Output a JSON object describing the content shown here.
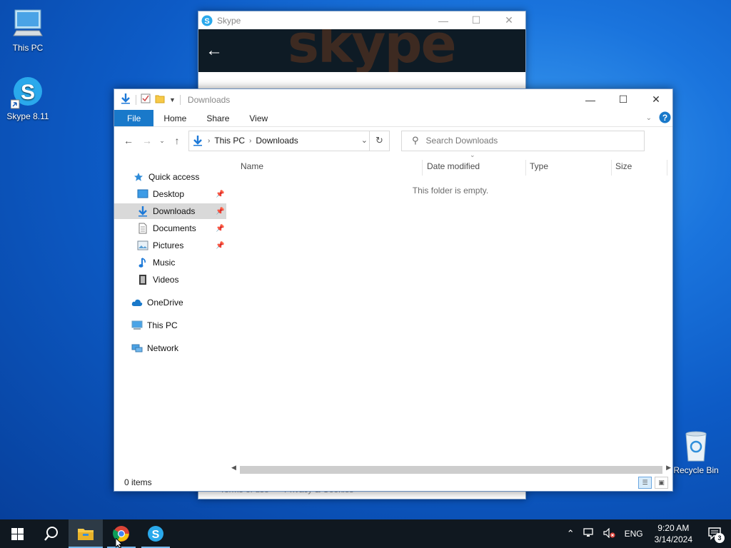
{
  "desktop": {
    "icons": [
      {
        "label": "This PC",
        "icon": "computer-icon"
      },
      {
        "label": "Skype 8.11",
        "icon": "skype-icon"
      },
      {
        "label": "Recycle Bin",
        "icon": "recycle-bin-icon"
      }
    ]
  },
  "skype_window": {
    "title": "Skype",
    "watermark": "skype",
    "footer_links": [
      "Terms of use",
      "Privacy & Cookies"
    ]
  },
  "explorer": {
    "title": "Downloads",
    "ribbon_tabs": [
      "File",
      "Home",
      "Share",
      "View"
    ],
    "address": {
      "crumbs": [
        "This PC",
        "Downloads"
      ]
    },
    "search": {
      "placeholder": "Search Downloads"
    },
    "nav": {
      "quick_access": "Quick access",
      "items": [
        {
          "label": "Desktop",
          "icon": "desktop-folder-icon",
          "pinned": true
        },
        {
          "label": "Downloads",
          "icon": "downloads-folder-icon",
          "pinned": true,
          "selected": true
        },
        {
          "label": "Documents",
          "icon": "documents-folder-icon",
          "pinned": true
        },
        {
          "label": "Pictures",
          "icon": "pictures-folder-icon",
          "pinned": true
        },
        {
          "label": "Music",
          "icon": "music-folder-icon",
          "pinned": false
        },
        {
          "label": "Videos",
          "icon": "videos-folder-icon",
          "pinned": false
        }
      ],
      "onedrive": "OneDrive",
      "this_pc": "This PC",
      "network": "Network"
    },
    "columns": [
      "Name",
      "Date modified",
      "Type",
      "Size"
    ],
    "empty_message": "This folder is empty.",
    "status": "0 items"
  },
  "taskbar": {
    "language": "ENG",
    "time": "9:20 AM",
    "date": "3/14/2024",
    "notification_count": "3"
  },
  "colors": {
    "accent": "#1979ca",
    "taskbar": "#101820",
    "desktop": "#0d5bc6"
  }
}
